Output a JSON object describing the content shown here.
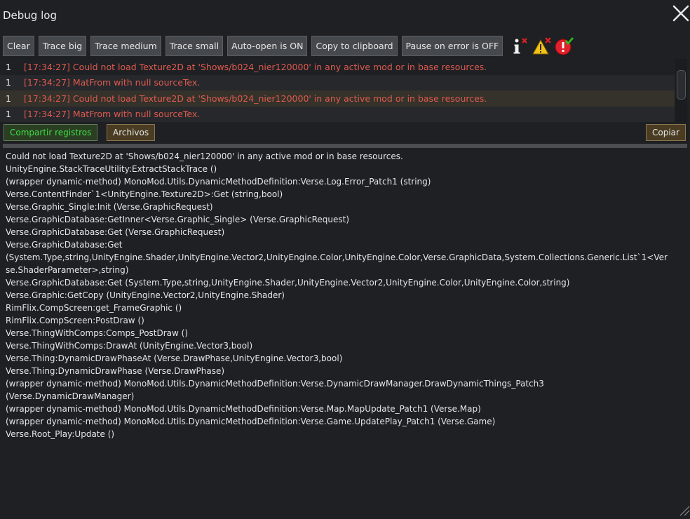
{
  "window": {
    "title": "Debug log"
  },
  "toolbar": {
    "buttons": [
      "Clear",
      "Trace big",
      "Trace medium",
      "Trace small",
      "Auto-open is ON",
      "Copy to clipboard",
      "Pause on error is OFF"
    ],
    "icons": [
      "info-disabled-icon",
      "warning-disabled-icon",
      "error-enabled-icon"
    ]
  },
  "log": {
    "rows": [
      {
        "count": "1",
        "message": "[17:34:27] Could not load Texture2D at 'Shows/b024_nier120000' in any active mod or in base resources."
      },
      {
        "count": "1",
        "message": "[17:34:27] MatFrom with null sourceTex."
      },
      {
        "count": "1",
        "message": "[17:34:27] Could not load Texture2D at 'Shows/b024_nier120000' in any active mod or in base resources."
      },
      {
        "count": "1",
        "message": "[17:34:27] MatFrom with null sourceTex."
      }
    ]
  },
  "actions": {
    "share": "Compartir registros",
    "files": "Archivos",
    "copy": "Copiar"
  },
  "details": {
    "text": "Could not load Texture2D at 'Shows/b024_nier120000' in any active mod or in base resources.\nUnityEngine.StackTraceUtility:ExtractStackTrace ()\n(wrapper dynamic-method) MonoMod.Utils.DynamicMethodDefinition:Verse.Log.Error_Patch1 (string)\nVerse.ContentFinder`1<UnityEngine.Texture2D>:Get (string,bool)\nVerse.Graphic_Single:Init (Verse.GraphicRequest)\nVerse.GraphicDatabase:GetInner<Verse.Graphic_Single> (Verse.GraphicRequest)\nVerse.GraphicDatabase:Get (Verse.GraphicRequest)\nVerse.GraphicDatabase:Get\n(System.Type,string,UnityEngine.Shader,UnityEngine.Vector2,UnityEngine.Color,UnityEngine.Color,Verse.GraphicData,System.Collections.Generic.List`1<Verse.ShaderParameter>,string)\nVerse.GraphicDatabase:Get (System.Type,string,UnityEngine.Shader,UnityEngine.Vector2,UnityEngine.Color,UnityEngine.Color,string)\nVerse.Graphic:GetCopy (UnityEngine.Vector2,UnityEngine.Shader)\nRimFlix.CompScreen:get_FrameGraphic ()\nRimFlix.CompScreen:PostDraw ()\nVerse.ThingWithComps:Comps_PostDraw ()\nVerse.ThingWithComps:DrawAt (UnityEngine.Vector3,bool)\nVerse.Thing:DynamicDrawPhaseAt (Verse.DrawPhase,UnityEngine.Vector3,bool)\nVerse.Thing:DynamicDrawPhase (Verse.DrawPhase)\n(wrapper dynamic-method) MonoMod.Utils.DynamicMethodDefinition:Verse.DynamicDrawManager.DrawDynamicThings_Patch3\n(Verse.DynamicDrawManager)\n(wrapper dynamic-method) MonoMod.Utils.DynamicMethodDefinition:Verse.Map.MapUpdate_Patch1 (Verse.Map)\n(wrapper dynamic-method) MonoMod.Utils.DynamicMethodDefinition:Verse.Game.UpdatePlay_Patch1 (Verse.Game)\nVerse.Root_Play:Update ()"
  },
  "colors": {
    "error_text": "#e05a4e",
    "share_text": "#3fe046"
  }
}
